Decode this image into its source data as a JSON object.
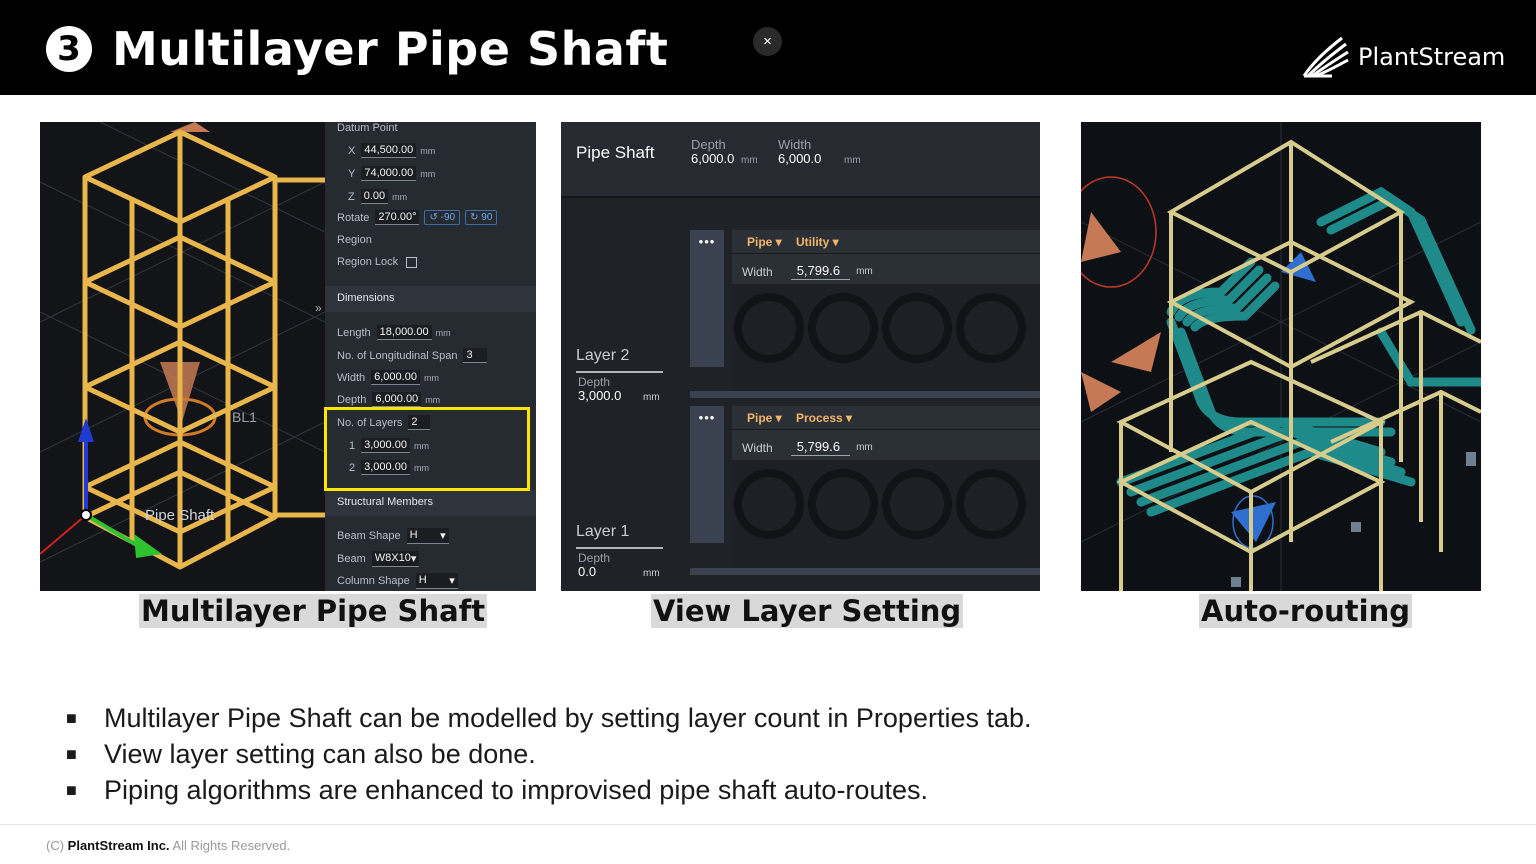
{
  "header": {
    "number": "❸",
    "title": "Multilayer Pipe Shaft",
    "close": "×",
    "logo": "PlantStream"
  },
  "panel1": {
    "caption": "Multilayer Pipe Shaft",
    "viewport_labels": {
      "bl": "BL1",
      "shaft": "Pipe Shaft",
      "expand": "»"
    },
    "props": {
      "datum_point": "Datum Point",
      "x_label": "X",
      "x_value": "44,500.00",
      "y_label": "Y",
      "y_value": "74,000.00",
      "z_label": "Z",
      "z_value": "0.00",
      "unit": "mm",
      "rotate_label": "Rotate",
      "rotate_value": "270.00°",
      "rot_left": "↺ -90",
      "rot_right": "↻ 90",
      "region": "Region",
      "region_lock": "Region Lock",
      "dimensions": "Dimensions",
      "length_label": "Length",
      "length_value": "18,000.00",
      "span_label": "No. of Longitudinal Span",
      "span_value": "3",
      "width_label": "Width",
      "width_value": "6,000.00",
      "depth_label": "Depth",
      "depth_value": "6,000.00",
      "layers_label": "No. of Layers",
      "layers_value": "2",
      "layer1_index": "1",
      "layer1_value": "3,000.00",
      "layer2_index": "2",
      "layer2_value": "3,000.00",
      "structural": "Structural Members",
      "beam_shape_label": "Beam Shape",
      "beam_shape_value": "H",
      "beam_label": "Beam",
      "beam_value": "W8X10",
      "column_shape_label": "Column Shape",
      "column_shape_value": "H"
    }
  },
  "panel2": {
    "caption": "View Layer Setting",
    "title": "Pipe Shaft",
    "depth_label": "Depth",
    "depth_value": "6,000.0",
    "width_label": "Width",
    "width_value": "6,000.0",
    "unit": "mm",
    "layer2": {
      "label": "Layer 2",
      "depth_label": "Depth",
      "depth_value": "3,000.0"
    },
    "layer1": {
      "label": "Layer 1",
      "depth_label": "Depth",
      "depth_value": "0.0"
    },
    "block_top": {
      "type": "Pipe",
      "category": "Utility",
      "width_label": "Width",
      "width_value": "5,799.6"
    },
    "block_bottom": {
      "type": "Pipe",
      "category": "Process",
      "width_label": "Width",
      "width_value": "5,799.6"
    },
    "dots": "•••"
  },
  "panel3": {
    "caption": "Auto-routing"
  },
  "bullets": [
    "Multilayer Pipe Shaft can be modelled by setting layer count in Properties tab.",
    "View layer setting can also be done.",
    "Piping algorithms are enhanced to improvised pipe shaft auto-routes."
  ],
  "bullet_mark": "■",
  "footer": {
    "copyright": "(C)",
    "company": "PlantStream Inc.",
    "rights": "All Rights Reserved."
  },
  "colors": {
    "frame_gold": "#e8b64a",
    "pipe_teal": "#1f8a8a",
    "highlight": "#ffe600",
    "accent_orange": "#f3b56a"
  }
}
